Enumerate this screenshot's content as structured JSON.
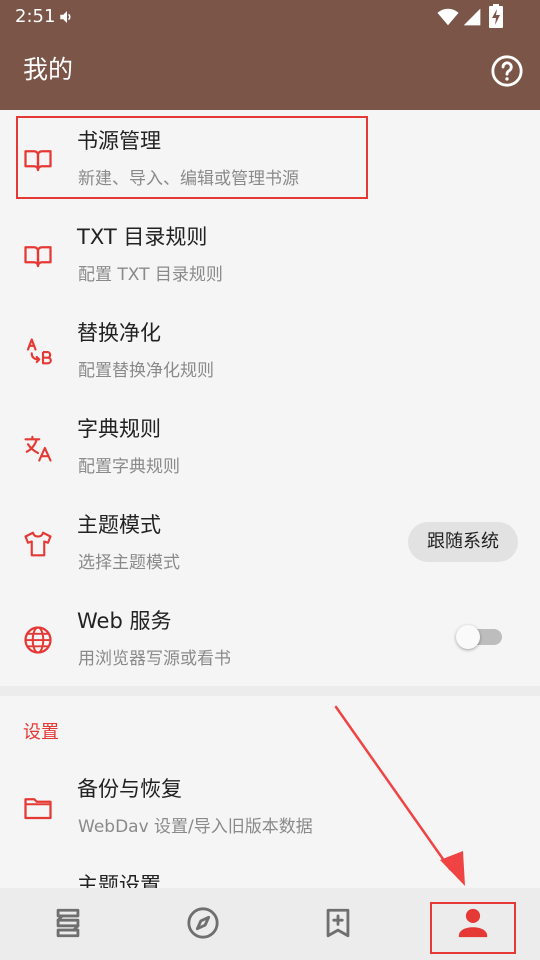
{
  "status_bar": {
    "time": "2:51",
    "icons": [
      "volume-icon",
      "wifi-icon",
      "signal-icon",
      "battery-icon"
    ]
  },
  "app_bar": {
    "title": "我的",
    "help_icon": "help-circle-icon"
  },
  "menu": {
    "items": [
      {
        "title": "书源管理",
        "subtitle": "新建、导入、编辑或管理书源",
        "icon": "book-open-icon"
      },
      {
        "title": "TXT 目录规则",
        "subtitle": "配置 TXT 目录规则",
        "icon": "book-open-icon"
      },
      {
        "title": "替换净化",
        "subtitle": "配置替换净化规则",
        "icon": "replace-icon"
      },
      {
        "title": "字典规则",
        "subtitle": "配置字典规则",
        "icon": "translate-icon"
      },
      {
        "title": "主题模式",
        "subtitle": "选择主题模式",
        "icon": "tshirt-icon",
        "value": "跟随系统"
      },
      {
        "title": "Web 服务",
        "subtitle": "用浏览器写源或看书",
        "icon": "globe-icon",
        "toggle": false
      }
    ]
  },
  "settings": {
    "header": "设置",
    "items": [
      {
        "title": "备份与恢复",
        "subtitle": "WebDav 设置/导入旧版本数据",
        "icon": "folder-icon"
      },
      {
        "title": "主题设置",
        "icon": "palette-icon"
      }
    ]
  },
  "bottom_nav": {
    "items": [
      {
        "icon": "bookshelf-icon",
        "selected": false
      },
      {
        "icon": "compass-icon",
        "selected": false
      },
      {
        "icon": "bookmark-add-icon",
        "selected": false
      },
      {
        "icon": "person-icon",
        "selected": true
      }
    ]
  },
  "colors": {
    "primary": "#7a5548",
    "accent": "#e53935",
    "background": "#f5f5f5",
    "inactive_icon": "#6f6f6f"
  }
}
